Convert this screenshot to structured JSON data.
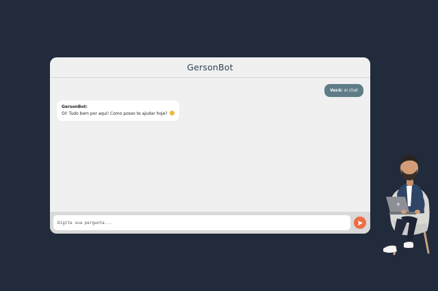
{
  "header": {
    "title": "GersonBot"
  },
  "messages": {
    "user": {
      "author": "Você:",
      "text": " oi chat"
    },
    "bot": {
      "author": "GersonBot:",
      "text": "Oi! Tudo bem por aqui! Como posso te ajudar hoje?"
    }
  },
  "input": {
    "placeholder": "Digite sua pergunta..."
  },
  "icons": {
    "send": "send-icon",
    "emoji": "smiling-face-icon"
  },
  "colors": {
    "background": "#222b3c",
    "accent": "#ee6d45",
    "user_bubble": "#5f7d89"
  }
}
